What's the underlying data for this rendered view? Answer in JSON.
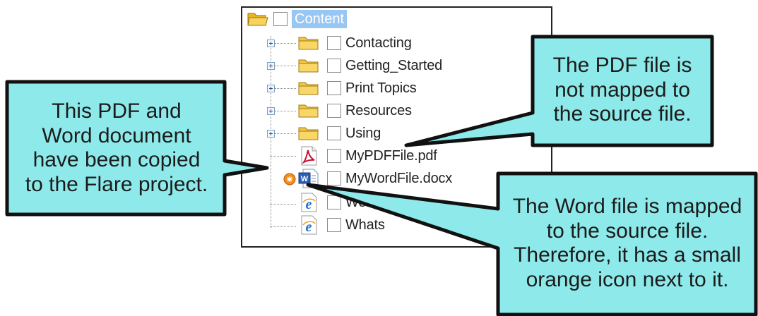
{
  "tree": {
    "root": {
      "label": "Content",
      "icon": "folder-open-icon"
    },
    "items": [
      {
        "label": "Contacting",
        "icon": "folder-icon",
        "expandable": true
      },
      {
        "label": "Getting_Started",
        "icon": "folder-icon",
        "expandable": true
      },
      {
        "label": "Print Topics",
        "icon": "folder-icon",
        "expandable": true
      },
      {
        "label": "Resources",
        "icon": "folder-icon",
        "expandable": true
      },
      {
        "label": "Using",
        "icon": "folder-icon",
        "expandable": true
      },
      {
        "label": "MyPDFFile.pdf",
        "icon": "pdf-file-icon",
        "expandable": false
      },
      {
        "label": "MyWordFile.docx",
        "icon": "word-file-icon",
        "expandable": false,
        "mapped_icon": "orange-link-icon"
      },
      {
        "label": "Welcome.htm",
        "icon": "html-file-icon",
        "expandable": false
      },
      {
        "label": "Whats",
        "icon": "html-file-icon",
        "expandable": false
      }
    ]
  },
  "callouts": {
    "left": {
      "lines": [
        "This PDF and",
        "Word document",
        "have been copied",
        "to the Flare project."
      ]
    },
    "top_right": {
      "lines": [
        "The PDF file is",
        "not mapped to",
        "the source file."
      ]
    },
    "bottom_right": {
      "lines": [
        "The Word file is mapped",
        "to the source file.",
        "Therefore, it has a small",
        "orange icon next to it."
      ]
    }
  },
  "colors": {
    "callout_fill": "#8eeaea",
    "selection": "#99c7f3",
    "folder": "#f4c542",
    "mapped_icon": "#f28c1e"
  }
}
